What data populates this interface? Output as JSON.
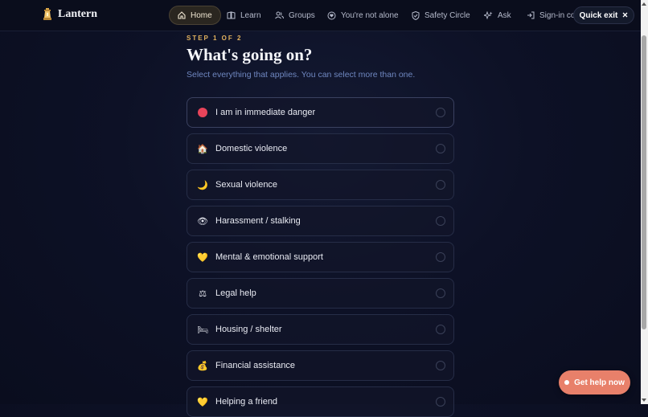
{
  "brand": {
    "name": "Lantern",
    "icon": "lantern-icon"
  },
  "nav": [
    {
      "key": "home",
      "label": "Home",
      "icon": "home-icon",
      "active": true
    },
    {
      "key": "learn",
      "label": "Learn",
      "icon": "book-icon"
    },
    {
      "key": "groups",
      "label": "Groups",
      "icon": "users-icon"
    },
    {
      "key": "not-alone",
      "label": "You're not alone",
      "icon": "chat-heart-icon"
    },
    {
      "key": "safety",
      "label": "Safety Circle",
      "icon": "shield-icon"
    },
    {
      "key": "ask",
      "label": "Ask",
      "icon": "sparkle-icon"
    },
    {
      "key": "signin",
      "label": "Sign-in co",
      "icon": "sign-in-icon"
    }
  ],
  "quick_exit": {
    "label": "Quick exit",
    "icon": "close-icon"
  },
  "step": "STEP 1 OF 2",
  "title": "What's going on?",
  "subtitle": "Select everything that applies. You can select more than one.",
  "options": [
    {
      "label": "I am in immediate danger",
      "icon": "red-circle-icon",
      "glyph": ""
    },
    {
      "label": "Domestic violence",
      "icon": "house-icon",
      "glyph": "🏠"
    },
    {
      "label": "Sexual violence",
      "icon": "crescent-moon-icon",
      "glyph": "🌙"
    },
    {
      "label": "Harassment / stalking",
      "icon": "eye-icon",
      "glyph": "👁"
    },
    {
      "label": "Mental & emotional support",
      "icon": "yellow-heart-icon",
      "glyph": "💛"
    },
    {
      "label": "Legal help",
      "icon": "scales-icon",
      "glyph": "⚖"
    },
    {
      "label": "Housing / shelter",
      "icon": "bed-icon",
      "glyph": "🛏"
    },
    {
      "label": "Financial assistance",
      "icon": "money-bag-icon",
      "glyph": "💰"
    },
    {
      "label": "Helping a friend",
      "icon": "heart-hands-icon",
      "glyph": "💛"
    }
  ],
  "get_help": {
    "label": "Get help now"
  },
  "colors": {
    "accent": "#e3b25e",
    "cta": "#e8806a",
    "danger": "#e8445a",
    "background": "#0d1126"
  }
}
